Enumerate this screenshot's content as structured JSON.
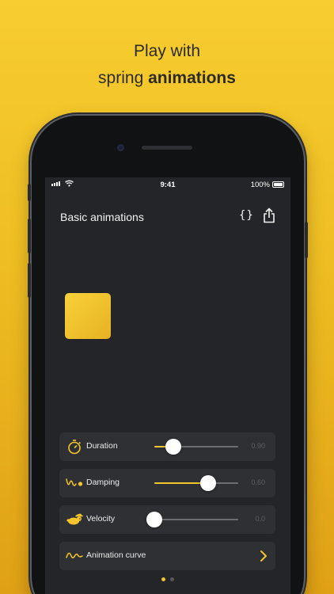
{
  "headline": {
    "line1": "Play with",
    "line2_prefix": "spring ",
    "line2_bold": "animations"
  },
  "status_bar": {
    "time": "9:41",
    "battery": "100%"
  },
  "nav": {
    "title": "Basic animations",
    "code_label": "{}",
    "share_icon": "share-icon"
  },
  "controls": [
    {
      "label": "Duration",
      "icon": "stopwatch-icon",
      "value": "0.90",
      "level": 0.23
    },
    {
      "label": "Damping",
      "icon": "damping-wave-icon",
      "value": "0.60",
      "level": 0.63
    },
    {
      "label": "Velocity",
      "icon": "rabbit-icon",
      "value": "0.0",
      "level": 0.0
    }
  ],
  "curve_row": {
    "label": "Animation curve",
    "icon": "curve-icon"
  },
  "page_indicator": {
    "count": 2,
    "active": 0
  },
  "colors": {
    "accent": "#f4c52c",
    "screen_bg": "#232528",
    "row_bg": "#2e3034",
    "background_top": "#f7cd30",
    "background_bottom": "#dfa016"
  }
}
